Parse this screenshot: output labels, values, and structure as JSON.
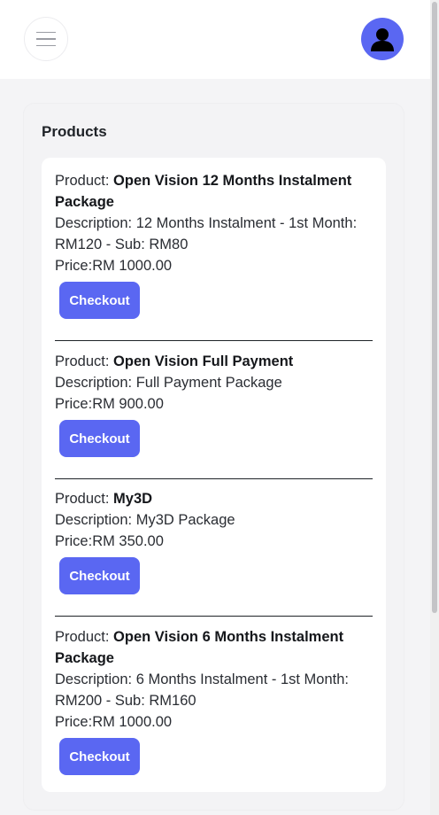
{
  "panel": {
    "title": "Products"
  },
  "labels": {
    "product_prefix": "Product: ",
    "description_prefix": "Description: ",
    "price_prefix": "Price:"
  },
  "products": [
    {
      "name": "Open Vision 12 Months Instalment Package",
      "description": "12 Months Instalment - 1st Month: RM120 - Sub: RM80",
      "price": "RM 1000.00",
      "button": "Checkout"
    },
    {
      "name": "Open Vision Full Payment",
      "description": "Full Payment Package",
      "price": "RM 900.00",
      "button": "Checkout"
    },
    {
      "name": "My3D",
      "description": "My3D Package",
      "price": "RM 350.00",
      "button": "Checkout"
    },
    {
      "name": "Open Vision 6 Months Instalment Package",
      "description": "6 Months Instalment - 1st Month: RM200 - Sub: RM160",
      "price": "RM 1000.00",
      "button": "Checkout"
    }
  ],
  "icons": {
    "menu": "hamburger-icon",
    "avatar": "user-icon"
  },
  "colors": {
    "accent": "#5a67f2"
  }
}
